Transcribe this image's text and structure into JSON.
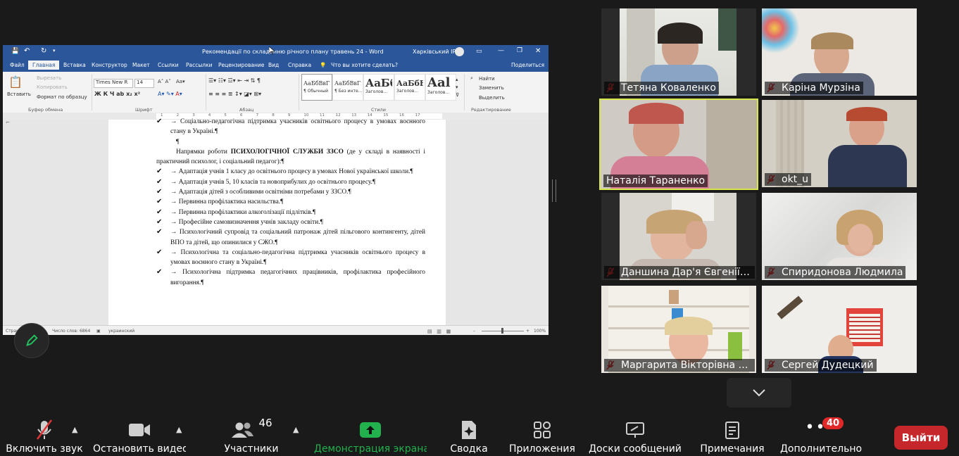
{
  "word": {
    "title": "Рекомендації по складанню річного плану травень 24  -  Word",
    "account": "Харківський ІРЦ",
    "tabs": [
      "Файл",
      "Главная",
      "Вставка",
      "Конструктор",
      "Макет",
      "Ссылки",
      "Рассылки",
      "Рецензирование",
      "Вид",
      "Справка"
    ],
    "tell_me": "Что вы хотите сделать?",
    "share": "Поделиться",
    "ribbon": {
      "paste": "Вставить",
      "cut": "Вырезать",
      "copy": "Копировать",
      "format_painter": "Формат по образцу",
      "clipboard_group": "Буфер обмена",
      "font_name": "Times New R",
      "font_size": "14",
      "font_group": "Шрифт",
      "paragraph_group": "Абзац",
      "styles_group": "Стили",
      "editing_group": "Редактирование",
      "find": "Найти",
      "replace": "Заменить",
      "select": "Выделить",
      "styles": [
        {
          "preview": "АаБбВвГг,",
          "name": "¶ Обычный"
        },
        {
          "preview": "АаБбВвГг,",
          "name": "¶ Без инте..."
        },
        {
          "preview": "АаБб",
          "name": "Заголов..."
        },
        {
          "preview": "АаБбЕ",
          "name": "Заголов..."
        },
        {
          "preview": "Aal",
          "name": "Заголов..."
        }
      ]
    },
    "ruler_nums": [
      "1",
      "2",
      "3",
      "4",
      "5",
      "6",
      "7",
      "8",
      "9",
      "10",
      "11",
      "12",
      "13",
      "14",
      "15",
      "16",
      "17"
    ],
    "doc": {
      "line_top": "→ Соціально-педагогічна підтримка учасників освітнього процесу в умовах воєнного стану в Україні.¶",
      "empty": "¶",
      "heading_pre": "Напрямки роботи ",
      "heading_bold": "ПСИХОЛОГІЧНОЇ СЛУЖБИ ЗЗСО",
      "heading_post": " (де у складі в наявності і практичний психолог, і соціальний педагог):¶",
      "check_mark": "✔",
      "items": [
        "→ Адаптація учнів 1 класу до освітнього процесу в умовах Нової української школи.¶",
        "→ Адаптація учнів 5, 10 класів та новоприбулих до освітнього процесу.¶",
        "→ Адаптація дітей з особливими освітніми потребами у ЗЗСО.¶",
        "→ Первинна профілактика насильства.¶",
        "→ Первинна профілактики алкоголізації підлітків.¶",
        "→ Професійне самовизначення учнів закладу освіти.¶",
        "→ Психологічний супровід та соціальний патронаж дітей пільгового контингенту, дітей ВПО та дітей, що опинилися у СЖО.¶",
        "→ Психологічна та соціально-педагогічна підтримка учасників освітнього процесу в умовах воєнного стану в Україні.¶",
        "→ Психологічна підтримка педагогічних працівників, профілактика професійного вигорання.¶"
      ]
    },
    "status": {
      "page": "Страница 23",
      "words": "Число слов: 6864",
      "language": "украинский",
      "zoom": "100%"
    }
  },
  "participants": [
    {
      "name": "Тетяна Коваленко"
    },
    {
      "name": "Каріна Мурзіна"
    },
    {
      "name": "Наталія Тараненко"
    },
    {
      "name": "okt_u"
    },
    {
      "name": "Даншина Дар'я Євгеніївна"
    },
    {
      "name": "Спиридонова Людмила"
    },
    {
      "name": "Маргарита Вікторівна Савченко"
    },
    {
      "name": "Сергей Дудецкий"
    }
  ],
  "toolbar": {
    "audio": "Включить звук",
    "video": "Остановить видео",
    "participants": "Участники",
    "participants_count": "46",
    "share": "Демонстрация экрана",
    "summary": "Сводка",
    "apps": "Приложения",
    "whiteboards": "Доски сообщений",
    "notes": "Примечания",
    "more": "Дополнительно",
    "more_badge": "40",
    "leave": "Выйти"
  },
  "colors": {
    "word_blue": "#2b579a",
    "active_speaker": "#d6e64b",
    "share_green": "#22b14c",
    "leave_red": "#c5272b",
    "badge_red": "#e02828"
  }
}
